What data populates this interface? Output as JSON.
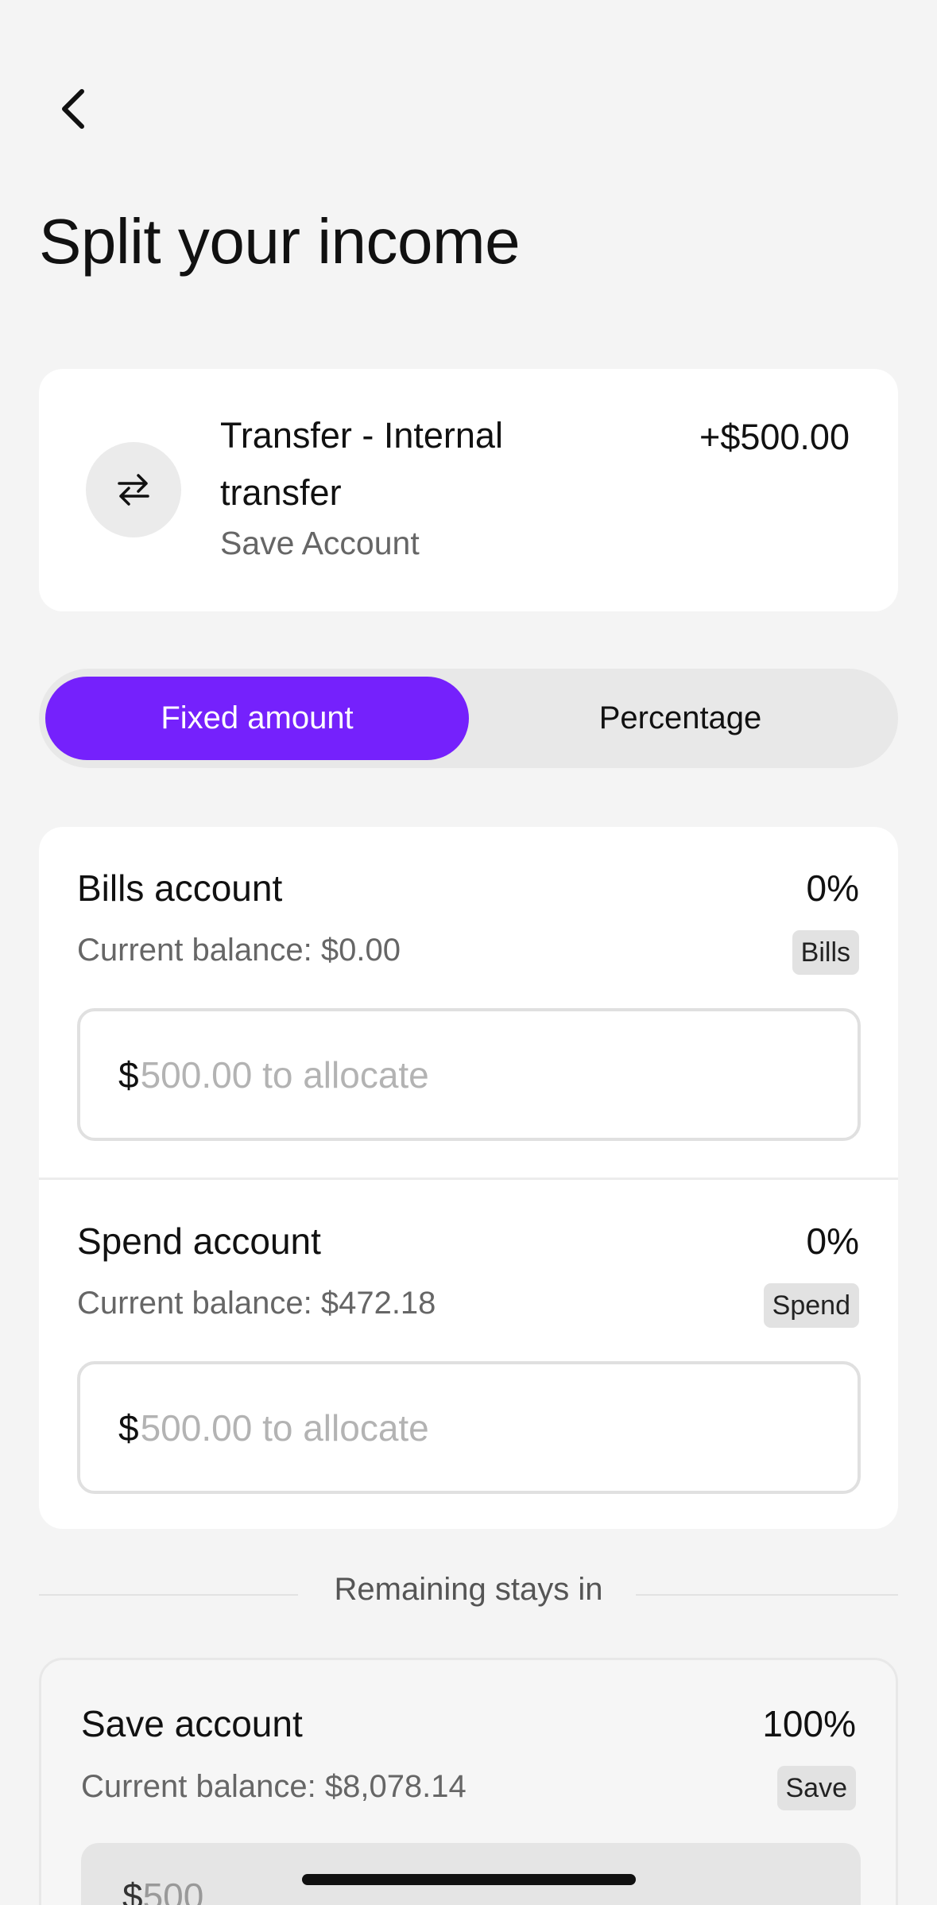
{
  "page": {
    "title": "Split your income"
  },
  "transaction": {
    "title": "Transfer - Internal transfer",
    "subtitle": "Save Account",
    "amount": "+$500.00",
    "icon": "transfer-arrows-icon"
  },
  "mode_toggle": {
    "options": [
      {
        "label": "Fixed amount",
        "selected": true
      },
      {
        "label": "Percentage",
        "selected": false
      }
    ],
    "accent_color": "#7521fc"
  },
  "accounts": [
    {
      "name": "Bills account",
      "percent": "0%",
      "balance": "Current balance: $0.00",
      "badge": "Bills",
      "currency_prefix": "$",
      "placeholder": "500.00 to allocate",
      "value": ""
    },
    {
      "name": "Spend account",
      "percent": "0%",
      "balance": "Current balance: $472.18",
      "badge": "Spend",
      "currency_prefix": "$",
      "placeholder": "500.00 to allocate",
      "value": ""
    }
  ],
  "remaining": {
    "label": "Remaining stays in"
  },
  "save_account": {
    "name": "Save account",
    "percent": "100%",
    "balance": "Current balance: $8,078.14",
    "badge": "Save",
    "currency_prefix": "$",
    "value": "500"
  }
}
